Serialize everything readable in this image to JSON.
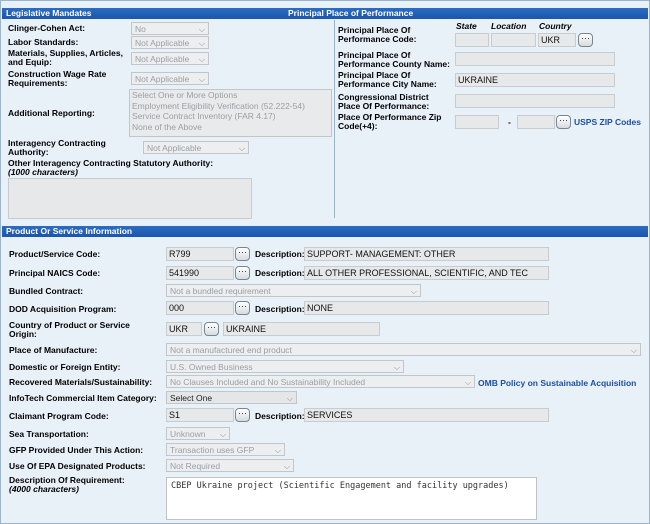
{
  "legislative": {
    "title": "Legislative Mandates",
    "ppop_title": "Principal Place of Performance",
    "clinger_label": "Clinger-Cohen Act:",
    "clinger_value": "No",
    "labor_label": "Labor Standards:",
    "labor_value": "Not Applicable",
    "materials_label": "Materials, Supplies, Articles, and Equip:",
    "materials_value": "Not Applicable",
    "construction_label": "Construction Wage Rate Requirements:",
    "construction_value": "Not Applicable",
    "additional_label": "Additional Reporting:",
    "additional_options": [
      "Select One or More Options",
      "Employment Eligibility Verification (52.222-54)",
      "Service Contract Inventory (FAR 4.17)",
      "None of the Above"
    ],
    "interagency_label": "Interagency Contracting Authority:",
    "interagency_value": "Not Applicable",
    "other_label": "Other Interagency Contracting Statutory Authority:",
    "other_hint": "(1000 characters)"
  },
  "ppop": {
    "state_header": "State",
    "location_header": "Location",
    "country_header": "Country",
    "code_label": "Principal Place Of Performance Code:",
    "country_value": "UKR",
    "county_label": "Principal Place Of Performance County Name:",
    "city_label": "Principal Place Of Performance City Name:",
    "city_value": "UKRAINE",
    "district_label": "Congressional District Place Of Performance:",
    "zip_label": "Place Of Performance Zip Code(+4):",
    "zip_sep": "-",
    "zip_link": "USPS ZIP Codes"
  },
  "product": {
    "title": "Product Or Service Information",
    "psc_label": "Product/Service Code:",
    "psc_value": "R799",
    "desc_label": "Description:",
    "psc_desc": "SUPPORT- MANAGEMENT: OTHER",
    "naics_label": "Principal NAICS Code:",
    "naics_value": "541990",
    "naics_desc": "ALL OTHER PROFESSIONAL, SCIENTIFIC, AND TEC",
    "bundled_label": "Bundled Contract:",
    "bundled_value": "Not a bundled requirement",
    "dod_label": "DOD Acquisition Program:",
    "dod_value": "000",
    "dod_desc": "NONE",
    "origin_label": "Country of Product or Service Origin:",
    "origin_code": "UKR",
    "origin_name": "UKRAINE",
    "manufacture_label": "Place of Manufacture:",
    "manufacture_value": "Not a manufactured end product",
    "domestic_label": "Domestic or Foreign Entity:",
    "domestic_value": "U.S. Owned Business",
    "recovered_label": "Recovered Materials/Sustainability:",
    "recovered_value": "No Clauses Included and No Sustainability Included",
    "omb_link": "OMB Policy on Sustainable Acquisition",
    "infotech_label": "InfoTech Commercial Item Category:",
    "infotech_value": "Select One",
    "claimant_label": "Claimant Program Code:",
    "claimant_value": "S1",
    "claimant_desc": "SERVICES",
    "sea_label": "Sea Transportation:",
    "sea_value": "Unknown",
    "gfp_label": "GFP Provided Under This Action:",
    "gfp_value": "Transaction uses GFP",
    "epa_label": "Use Of EPA Designated Products:",
    "epa_value": "Not Required",
    "req_label": "Description Of Requirement:",
    "req_hint": "(4000 characters)",
    "req_value": "CBEP Ukraine project (Scientific Engagement and facility upgrades)"
  },
  "icons": {
    "lookup": "ellipsis-icon",
    "dropdown": "chevron-down-icon"
  }
}
